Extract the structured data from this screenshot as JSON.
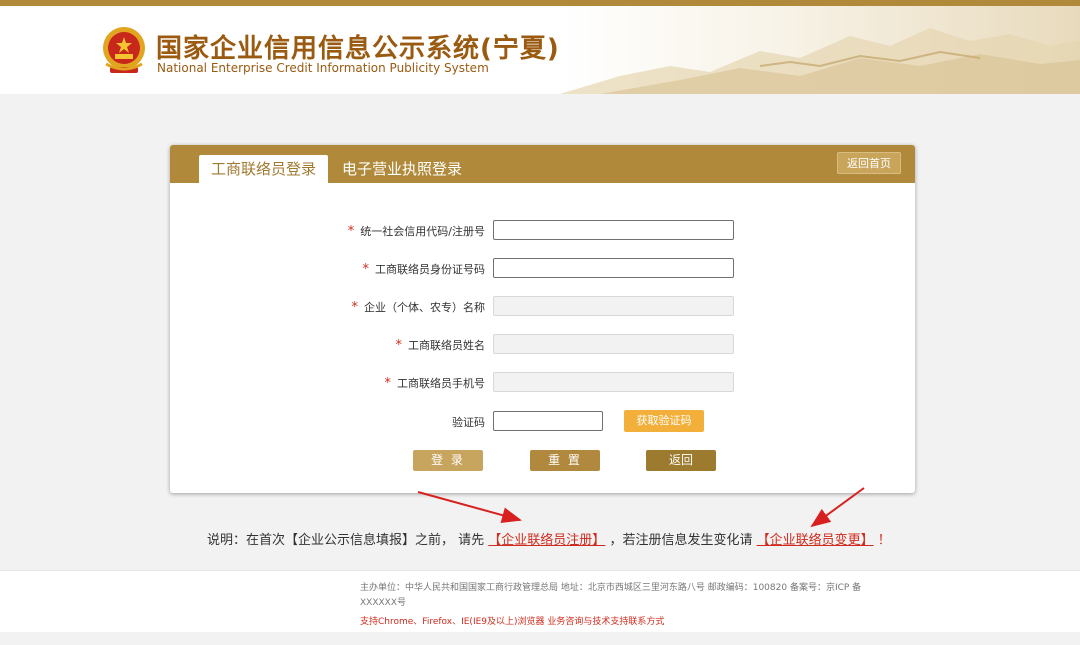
{
  "header": {
    "title_cn": "国家企业信用信息公示系统(宁夏)",
    "title_en": "National Enterprise Credit Information Publicity System"
  },
  "tabs": {
    "active": "工商联络员登录",
    "inactive": "电子营业执照登录"
  },
  "home_button": "返回首页",
  "form": {
    "credit_code_label": "统一社会信用代码/注册号",
    "id_card_label": "工商联络员身份证号码",
    "company_name_label": "企业（个体、农专）名称",
    "liaison_name_label": "工商联络员姓名",
    "phone_label": "工商联络员手机号",
    "captcha_label": "验证码",
    "required_mark": "*",
    "get_code_button": "获取验证码",
    "login_button": "登 录",
    "reset_button": "重 置",
    "back_button": "返回"
  },
  "note": {
    "prefix": "说明：在首次【企业公示信息填报】之前，  请先",
    "register_link": "【企业联络员注册】",
    "middle": "，若注册信息发生变化请",
    "change_link": "【企业联络员变更】",
    "suffix": "！"
  },
  "footer": {
    "info": "主办单位：中华人民共和国国家工商行政管理总局 地址：北京市西城区三里河东路八号 邮政编码：100820 备案号：京ICP 备XXXXXX号",
    "support": "支持Chrome、Firefox、IE(IE9及以上)浏览器 业务咨询与技术支持联系方式"
  },
  "colors": {
    "brand": "#b08a3a",
    "title": "#9a5a10",
    "required": "#d02b1e",
    "get_code": "#f2b03a"
  }
}
